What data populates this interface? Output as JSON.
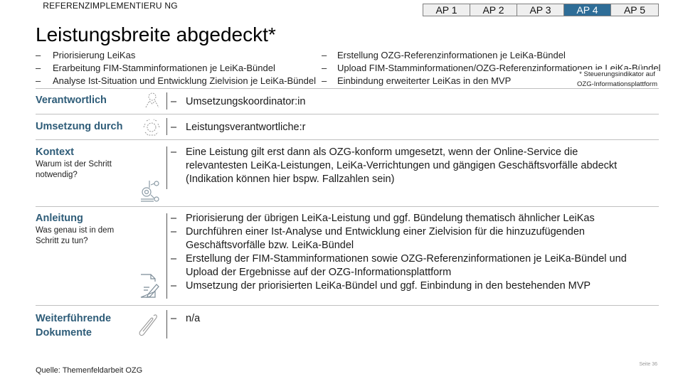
{
  "header": {
    "kicker": "REFERENZIMPLEMENTIERU NG",
    "title": "Leistungsbreite abgedeckt*"
  },
  "ap_nav": {
    "tabs": [
      {
        "label": "AP 1",
        "active": false
      },
      {
        "label": "AP 2",
        "active": false
      },
      {
        "label": "AP 3",
        "active": false
      },
      {
        "label": "AP 4",
        "active": true
      },
      {
        "label": "AP 5",
        "active": false
      }
    ],
    "active_color": "#2e6d97"
  },
  "scope": {
    "left": [
      "Priorisierung LeiKas",
      "Erarbeitung FIM-Stamminformationen je LeiKa-Bündel",
      "Analyse Ist-Situation und Entwicklung Zielvision je LeiKa-Bündel"
    ],
    "right": [
      "Erstellung OZG-Referenzinformationen je LeiKa-Bündel",
      "Upload FIM-Stamminformationen/OZG-Referenzinformationen je LeiKa-Bündel",
      "Einbindung erweiterter LeiKas in den MVP"
    ],
    "dash": "–"
  },
  "footnote": {
    "line1": "* Steuerungsindikator auf",
    "line2": "OZG-Informationsplattform"
  },
  "rows": {
    "verantwortlich": {
      "label": "Verantwortlich",
      "icon": "person-icon",
      "items": [
        "Umsetzungskoordinator:in"
      ]
    },
    "umsetzung": {
      "label": "Umsetzung durch",
      "icon": "team-icon",
      "items": [
        "Leistungsverantwortliche:r"
      ]
    },
    "kontext": {
      "label": "Kontext",
      "sub": "Warum ist der Schritt notwendig?",
      "icon": "network-icon",
      "items": [
        "Eine Leistung gilt erst dann als OZG-konform umgesetzt, wenn der Online-Service die relevantesten LeiKa-Leistungen, LeiKa-Verrichtungen und gängigen Geschäftsvorfälle abdeckt (Indikation können hier bspw. Fallzahlen sein)"
      ]
    },
    "anleitung": {
      "label": "Anleitung",
      "sub": "Was genau ist in dem Schritt zu tun?",
      "icon": "document-edit-icon",
      "items": [
        "Priorisierung der übrigen LeiKa-Leistung und ggf. Bündelung thematisch ähnlicher LeiKas",
        "Durchführen einer Ist-Analyse und Entwicklung einer Zielvision für die hinzuzufügenden Geschäftsvorfälle bzw. LeiKa-Bündel",
        "Erstellung der FIM-Stamminformationen sowie OZG-Referenzinformationen je LeiKa-Bündel und Upload der Ergebnisse auf der OZG-Informationsplattform",
        "Umsetzung der priorisierten LeiKa-Bündel und ggf. Einbindung in den bestehenden MVP"
      ]
    },
    "dokumente": {
      "label": "Weiterführende Dokumente",
      "icon": "paperclip-icon",
      "items": [
        "n/a"
      ]
    }
  },
  "footer": {
    "source": "Quelle: Themenfeldarbeit OZG",
    "page": "Seite 36"
  }
}
